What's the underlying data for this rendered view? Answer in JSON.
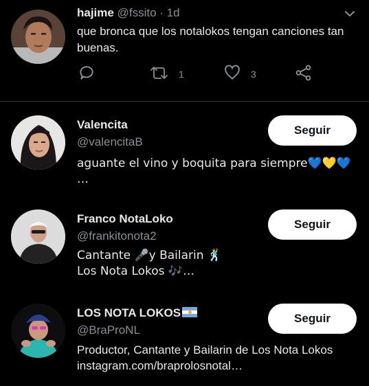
{
  "tweet": {
    "author_name": "hajime",
    "author_handle": "@fssito",
    "separator": "·",
    "time": "1d",
    "text": "que bronca que los notalokos tengan canciones tan buenas.",
    "reply_count": "",
    "retweet_count": "1",
    "like_count": "3"
  },
  "suggestions": [
    {
      "name": "Valencita",
      "handle": "@valencitaB",
      "bio_line1": "aguante el vino y boquita para siempre💙💛💙",
      "bio_line2": "…",
      "follow_label": "Seguir"
    },
    {
      "name": "Franco NotaLoko",
      "handle": "@frankitonota2",
      "bio_line1": "Cantante 🎤y Bailarin 🕺",
      "bio_line2": "Los Nota Lokos 🎶…",
      "follow_label": "Seguir"
    },
    {
      "name": "LOS NOTA LOKOS",
      "handle": "@BraProNL",
      "bio_line1": "Productor, Cantante y Bailarin de Los Nota Lokos",
      "bio_line2": "instagram.com/braprolosnotal…",
      "follow_label": "Seguir"
    }
  ],
  "colors": {
    "background": "#000000",
    "primary_text": "#e7e9ea",
    "secondary_text": "#8b8f94",
    "divider": "#2f3336",
    "follow_button_bg": "#ffffff",
    "follow_button_text": "#0f1419"
  },
  "icons": [
    "chevron-down-icon",
    "reply-icon",
    "retweet-icon",
    "like-icon",
    "share-icon",
    "argentina-flag-icon"
  ]
}
